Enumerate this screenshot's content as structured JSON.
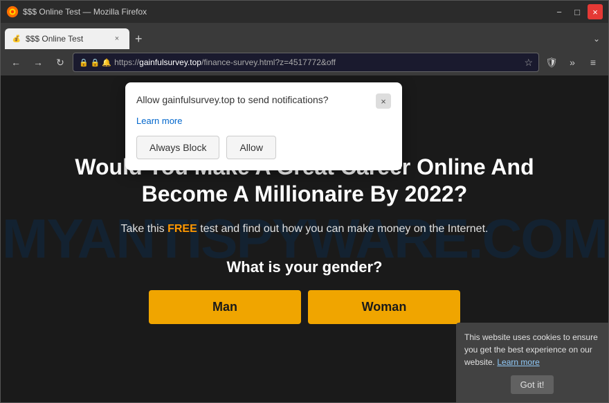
{
  "browser": {
    "title": "$$$ Online Test — Mozilla Firefox",
    "tab_title": "$$$ Online Test",
    "url_highlight": "gainfulsurvey.top",
    "url_full": "https://gainfulsurvey.top/finance-survey.html?z=4517772&off",
    "minimize_label": "−",
    "restore_label": "□",
    "close_label": "×",
    "back_label": "←",
    "forward_label": "→",
    "reload_label": "↻",
    "new_tab_label": "+",
    "tab_list_label": "⌄",
    "menu_label": "≡",
    "extensions_label": "»",
    "bookmark_label": "☆",
    "shield_label": "🛡"
  },
  "notification": {
    "title": "Allow gainfulsurvey.top to send notifications?",
    "learn_more": "Learn more",
    "always_block_label": "Always Block",
    "allow_label": "Allow",
    "close_label": "×"
  },
  "website": {
    "watermark": "MYANTISPYWARE.COM",
    "heading_line1": "Would You Make A Great Career Online And",
    "heading_line2": "Become A Millionaire By 2022?",
    "subtext_before": "Take this ",
    "subtext_free": "FREE",
    "subtext_after": " test and find out how you can make money on the Internet.",
    "gender_question": "What is your gender?",
    "btn_man": "Man",
    "btn_woman": "Woman"
  },
  "cookie": {
    "text": "This website uses cookies to ensure you get the best experience on our website.",
    "learn_more": "Learn more",
    "button_label": "Got it!"
  }
}
